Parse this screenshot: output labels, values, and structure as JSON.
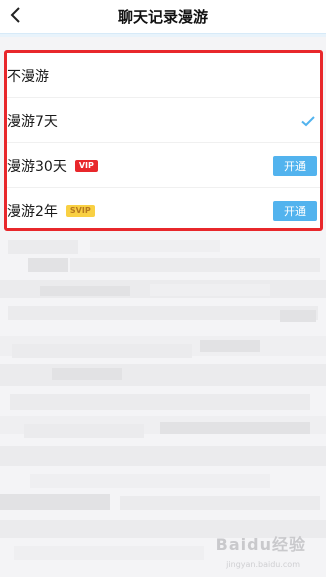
{
  "header": {
    "title": "聊天记录漫游",
    "back_icon": "chevron-left-icon"
  },
  "options": [
    {
      "label": "不漫游",
      "badge": null,
      "selected": false,
      "action": null
    },
    {
      "label": "漫游7天",
      "badge": null,
      "selected": true,
      "action": null
    },
    {
      "label": "漫游30天",
      "badge": "VIP",
      "selected": false,
      "action": "开通"
    },
    {
      "label": "漫游2年",
      "badge": "SVIP",
      "selected": false,
      "action": "开通"
    }
  ],
  "colors": {
    "accent": "#52b3ee",
    "highlight_border": "#e8272b",
    "vip_badge": "#e8272b",
    "svip_badge": "#f9d043"
  },
  "watermark": {
    "text": "Baidu经验",
    "sub": "jingyan.baidu.com"
  }
}
